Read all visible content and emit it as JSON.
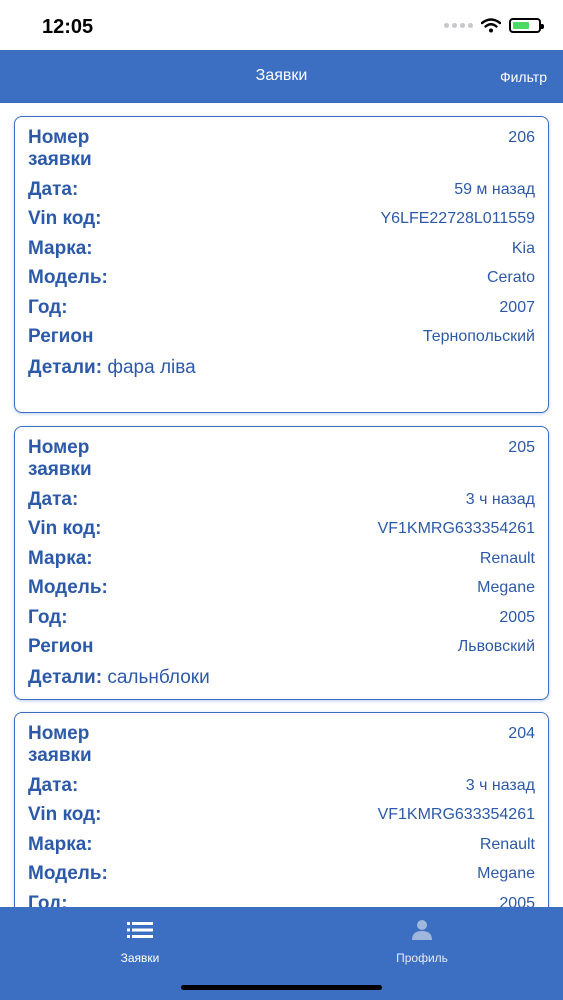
{
  "status": {
    "time": "12:05",
    "battery_level": 0.7
  },
  "header": {
    "title": "Заявки",
    "filter_label": "Фильтр"
  },
  "labels": {
    "number": "Номер\nзаявки",
    "date": "Дата:",
    "vin": "Vin код:",
    "brand": "Марка:",
    "model": "Модель:",
    "year": "Год:",
    "region": "Регион",
    "details": "Детали:"
  },
  "requests": [
    {
      "number": "206",
      "date": "59 м назад",
      "vin": "Y6LFE22728L011559",
      "brand": "Kia",
      "model": "Cerato",
      "year": "2007",
      "region": "Тернопольский",
      "details": "фара ліва"
    },
    {
      "number": "205",
      "date": "3 ч назад",
      "vin": "VF1KMRG633354261",
      "brand": "Renault",
      "model": "Megane",
      "year": "2005",
      "region": "Львовский",
      "details": "сальнблоки"
    },
    {
      "number": "204",
      "date": "3 ч назад",
      "vin": "VF1KMRG633354261",
      "brand": "Renault",
      "model": "Megane",
      "year": "2005"
    }
  ],
  "tabbar": {
    "requests_label": "Заявки",
    "profile_label": "Профиль"
  },
  "colors": {
    "primary": "#3c6fc2",
    "text": "#2d5aa8"
  },
  "icons": {
    "requests_tab": "list-icon",
    "profile_tab": "person-icon"
  }
}
